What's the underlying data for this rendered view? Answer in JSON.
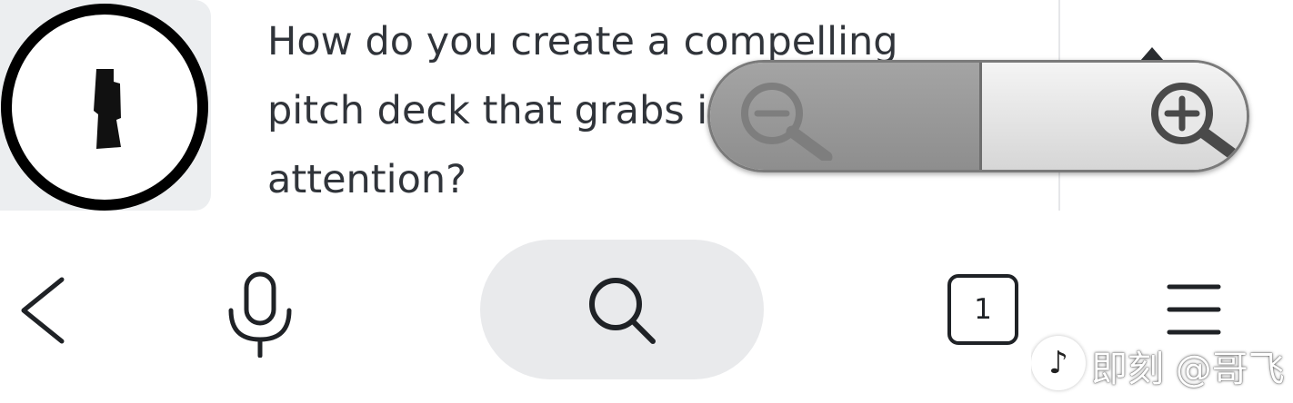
{
  "question": {
    "lines": [
      "How do you create a compelling",
      "pitch deck that grabs i",
      "attention?"
    ]
  },
  "zoom": {
    "out_icon": "zoom-out-icon",
    "in_icon": "zoom-in-icon"
  },
  "bottom_nav": {
    "back_icon": "back-chevron-icon",
    "mic_icon": "microphone-icon",
    "search_icon": "search-icon",
    "tab_count": "1",
    "menu_icon": "menu-icon"
  },
  "watermark": {
    "logo_glyph": "♪",
    "text": "即刻 @哥飞"
  },
  "colors": {
    "text": "#30343a",
    "icon": "#1f2226",
    "pill": "#e9eaec"
  }
}
